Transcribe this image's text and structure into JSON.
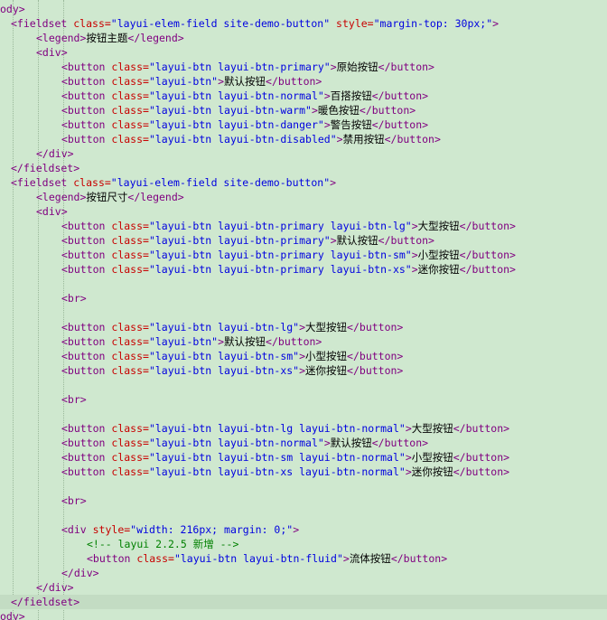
{
  "editor": {
    "current_line": 41,
    "lines": [
      {
        "indent": 0,
        "tokens": [
          [
            "t",
            "ody>"
          ]
        ]
      },
      {
        "indent": 1,
        "tokens": [
          [
            "t",
            "<fieldset "
          ],
          [
            "a",
            "class="
          ],
          [
            "v",
            "\"layui-elem-field site-demo-button\""
          ],
          [
            "a",
            " style="
          ],
          [
            "v",
            "\"margin-top: 30px;\""
          ],
          [
            "t",
            ">"
          ]
        ]
      },
      {
        "indent": 2,
        "tokens": [
          [
            "t",
            "<legend>"
          ],
          [
            "x",
            "按钮主题"
          ],
          [
            "t",
            "</legend>"
          ]
        ]
      },
      {
        "indent": 2,
        "tokens": [
          [
            "t",
            "<div>"
          ]
        ]
      },
      {
        "indent": 3,
        "tokens": [
          [
            "t",
            "<button "
          ],
          [
            "a",
            "class="
          ],
          [
            "v",
            "\"layui-btn layui-btn-primary\""
          ],
          [
            "t",
            ">"
          ],
          [
            "x",
            "原始按钮"
          ],
          [
            "t",
            "</button>"
          ]
        ]
      },
      {
        "indent": 3,
        "tokens": [
          [
            "t",
            "<button "
          ],
          [
            "a",
            "class="
          ],
          [
            "v",
            "\"layui-btn\""
          ],
          [
            "t",
            ">"
          ],
          [
            "x",
            "默认按钮"
          ],
          [
            "t",
            "</button>"
          ]
        ]
      },
      {
        "indent": 3,
        "tokens": [
          [
            "t",
            "<button "
          ],
          [
            "a",
            "class="
          ],
          [
            "v",
            "\"layui-btn layui-btn-normal\""
          ],
          [
            "t",
            ">"
          ],
          [
            "x",
            "百搭按钮"
          ],
          [
            "t",
            "</button>"
          ]
        ]
      },
      {
        "indent": 3,
        "tokens": [
          [
            "t",
            "<button "
          ],
          [
            "a",
            "class="
          ],
          [
            "v",
            "\"layui-btn layui-btn-warm\""
          ],
          [
            "t",
            ">"
          ],
          [
            "x",
            "暖色按钮"
          ],
          [
            "t",
            "</button>"
          ]
        ]
      },
      {
        "indent": 3,
        "tokens": [
          [
            "t",
            "<button "
          ],
          [
            "a",
            "class="
          ],
          [
            "v",
            "\"layui-btn layui-btn-danger\""
          ],
          [
            "t",
            ">"
          ],
          [
            "x",
            "警告按钮"
          ],
          [
            "t",
            "</button>"
          ]
        ]
      },
      {
        "indent": 3,
        "tokens": [
          [
            "t",
            "<button "
          ],
          [
            "a",
            "class="
          ],
          [
            "v",
            "\"layui-btn layui-btn-disabled\""
          ],
          [
            "t",
            ">"
          ],
          [
            "x",
            "禁用按钮"
          ],
          [
            "t",
            "</button>"
          ]
        ]
      },
      {
        "indent": 2,
        "tokens": [
          [
            "t",
            "</div>"
          ]
        ]
      },
      {
        "indent": 1,
        "tokens": [
          [
            "t",
            "</fieldset>"
          ]
        ]
      },
      {
        "indent": 1,
        "tokens": [
          [
            "t",
            "<fieldset "
          ],
          [
            "a",
            "class="
          ],
          [
            "v",
            "\"layui-elem-field site-demo-button\""
          ],
          [
            "t",
            ">"
          ]
        ]
      },
      {
        "indent": 2,
        "tokens": [
          [
            "t",
            "<legend>"
          ],
          [
            "x",
            "按钮尺寸"
          ],
          [
            "t",
            "</legend>"
          ]
        ]
      },
      {
        "indent": 2,
        "tokens": [
          [
            "t",
            "<div>"
          ]
        ]
      },
      {
        "indent": 3,
        "tokens": [
          [
            "t",
            "<button "
          ],
          [
            "a",
            "class="
          ],
          [
            "v",
            "\"layui-btn layui-btn-primary layui-btn-lg\""
          ],
          [
            "t",
            ">"
          ],
          [
            "x",
            "大型按钮"
          ],
          [
            "t",
            "</button>"
          ]
        ]
      },
      {
        "indent": 3,
        "tokens": [
          [
            "t",
            "<button "
          ],
          [
            "a",
            "class="
          ],
          [
            "v",
            "\"layui-btn layui-btn-primary\""
          ],
          [
            "t",
            ">"
          ],
          [
            "x",
            "默认按钮"
          ],
          [
            "t",
            "</button>"
          ]
        ]
      },
      {
        "indent": 3,
        "tokens": [
          [
            "t",
            "<button "
          ],
          [
            "a",
            "class="
          ],
          [
            "v",
            "\"layui-btn layui-btn-primary layui-btn-sm\""
          ],
          [
            "t",
            ">"
          ],
          [
            "x",
            "小型按钮"
          ],
          [
            "t",
            "</button>"
          ]
        ]
      },
      {
        "indent": 3,
        "tokens": [
          [
            "t",
            "<button "
          ],
          [
            "a",
            "class="
          ],
          [
            "v",
            "\"layui-btn layui-btn-primary layui-btn-xs\""
          ],
          [
            "t",
            ">"
          ],
          [
            "x",
            "迷你按钮"
          ],
          [
            "t",
            "</button>"
          ]
        ]
      },
      {
        "indent": 3,
        "tokens": []
      },
      {
        "indent": 3,
        "tokens": [
          [
            "t",
            "<br>"
          ]
        ]
      },
      {
        "indent": 3,
        "tokens": []
      },
      {
        "indent": 3,
        "tokens": [
          [
            "t",
            "<button "
          ],
          [
            "a",
            "class="
          ],
          [
            "v",
            "\"layui-btn layui-btn-lg\""
          ],
          [
            "t",
            ">"
          ],
          [
            "x",
            "大型按钮"
          ],
          [
            "t",
            "</button>"
          ]
        ]
      },
      {
        "indent": 3,
        "tokens": [
          [
            "t",
            "<button "
          ],
          [
            "a",
            "class="
          ],
          [
            "v",
            "\"layui-btn\""
          ],
          [
            "t",
            ">"
          ],
          [
            "x",
            "默认按钮"
          ],
          [
            "t",
            "</button>"
          ]
        ]
      },
      {
        "indent": 3,
        "tokens": [
          [
            "t",
            "<button "
          ],
          [
            "a",
            "class="
          ],
          [
            "v",
            "\"layui-btn layui-btn-sm\""
          ],
          [
            "t",
            ">"
          ],
          [
            "x",
            "小型按钮"
          ],
          [
            "t",
            "</button>"
          ]
        ]
      },
      {
        "indent": 3,
        "tokens": [
          [
            "t",
            "<button "
          ],
          [
            "a",
            "class="
          ],
          [
            "v",
            "\"layui-btn layui-btn-xs\""
          ],
          [
            "t",
            ">"
          ],
          [
            "x",
            "迷你按钮"
          ],
          [
            "t",
            "</button>"
          ]
        ]
      },
      {
        "indent": 3,
        "tokens": []
      },
      {
        "indent": 3,
        "tokens": [
          [
            "t",
            "<br>"
          ]
        ]
      },
      {
        "indent": 3,
        "tokens": []
      },
      {
        "indent": 3,
        "tokens": [
          [
            "t",
            "<button "
          ],
          [
            "a",
            "class="
          ],
          [
            "v",
            "\"layui-btn layui-btn-lg layui-btn-normal\""
          ],
          [
            "t",
            ">"
          ],
          [
            "x",
            "大型按钮"
          ],
          [
            "t",
            "</button>"
          ]
        ]
      },
      {
        "indent": 3,
        "tokens": [
          [
            "t",
            "<button "
          ],
          [
            "a",
            "class="
          ],
          [
            "v",
            "\"layui-btn layui-btn-normal\""
          ],
          [
            "t",
            ">"
          ],
          [
            "x",
            "默认按钮"
          ],
          [
            "t",
            "</button>"
          ]
        ]
      },
      {
        "indent": 3,
        "tokens": [
          [
            "t",
            "<button "
          ],
          [
            "a",
            "class="
          ],
          [
            "v",
            "\"layui-btn layui-btn-sm layui-btn-normal\""
          ],
          [
            "t",
            ">"
          ],
          [
            "x",
            "小型按钮"
          ],
          [
            "t",
            "</button>"
          ]
        ]
      },
      {
        "indent": 3,
        "tokens": [
          [
            "t",
            "<button "
          ],
          [
            "a",
            "class="
          ],
          [
            "v",
            "\"layui-btn layui-btn-xs layui-btn-normal\""
          ],
          [
            "t",
            ">"
          ],
          [
            "x",
            "迷你按钮"
          ],
          [
            "t",
            "</button>"
          ]
        ]
      },
      {
        "indent": 3,
        "tokens": []
      },
      {
        "indent": 3,
        "tokens": [
          [
            "t",
            "<br>"
          ]
        ]
      },
      {
        "indent": 3,
        "tokens": []
      },
      {
        "indent": 3,
        "tokens": [
          [
            "t",
            "<div "
          ],
          [
            "a",
            "style="
          ],
          [
            "v",
            "\"width: 216px; margin: 0;\""
          ],
          [
            "t",
            ">"
          ]
        ]
      },
      {
        "indent": 4,
        "tokens": [
          [
            "c",
            "<!-- layui 2.2.5 新增 -->"
          ]
        ]
      },
      {
        "indent": 4,
        "tokens": [
          [
            "t",
            "<button "
          ],
          [
            "a",
            "class="
          ],
          [
            "v",
            "\"layui-btn layui-btn-fluid\""
          ],
          [
            "t",
            ">"
          ],
          [
            "x",
            "流体按钮"
          ],
          [
            "t",
            "</button>"
          ]
        ]
      },
      {
        "indent": 3,
        "tokens": [
          [
            "t",
            "</div>"
          ]
        ]
      },
      {
        "indent": 2,
        "tokens": [
          [
            "t",
            "</div>"
          ]
        ]
      },
      {
        "indent": 1,
        "tokens": [
          [
            "t",
            "</fieldset>"
          ]
        ]
      },
      {
        "indent": 0,
        "tokens": [
          [
            "t",
            "ody>"
          ]
        ]
      }
    ]
  }
}
